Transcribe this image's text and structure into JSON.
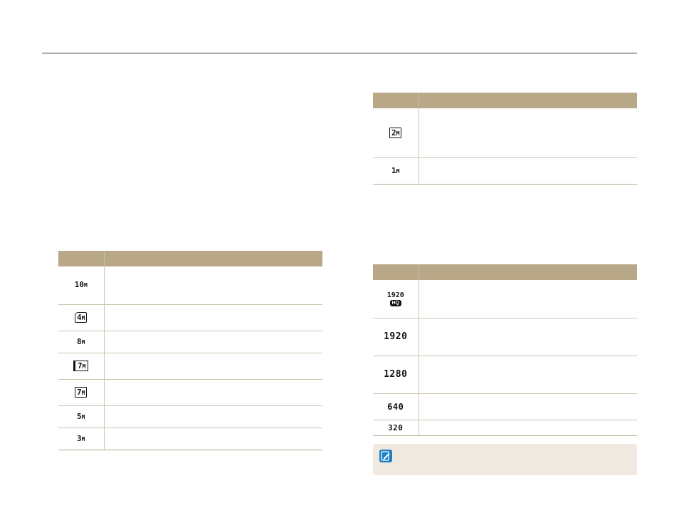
{
  "colors": {
    "table_header": "#b9a888",
    "row_divider": "#cfc3b0",
    "note_background": "#efe9e0",
    "note_icon": "#1d7fc4",
    "top_rule": "#3a3a3a"
  },
  "photo_size_table": {
    "header": [
      "",
      ""
    ],
    "rows": [
      {
        "icon": "10m-size-icon",
        "glyph": "10",
        "unit": "M",
        "style": "plain",
        "text": ""
      },
      {
        "icon": "4m-wide-size-icon",
        "glyph": "4",
        "unit": "M",
        "style": "pano",
        "text": ""
      },
      {
        "icon": "8m-size-icon",
        "glyph": "8",
        "unit": "M",
        "style": "plain",
        "text": ""
      },
      {
        "icon": "7m-wide-size-icon",
        "glyph": "7",
        "unit": "M",
        "style": "wide",
        "text": ""
      },
      {
        "icon": "7m-size-icon",
        "glyph": "7",
        "unit": "M",
        "style": "boxed",
        "text": ""
      },
      {
        "icon": "5m-size-icon",
        "glyph": "5",
        "unit": "M",
        "style": "plain",
        "text": ""
      },
      {
        "icon": "3m-size-icon",
        "glyph": "3",
        "unit": "M",
        "style": "plain",
        "text": ""
      }
    ]
  },
  "photo_size_table_cont": {
    "header": [
      "",
      ""
    ],
    "rows": [
      {
        "icon": "2m-wide-size-icon",
        "glyph": "2",
        "unit": "M",
        "style": "boxed",
        "text": ""
      },
      {
        "icon": "1m-size-icon",
        "glyph": "1",
        "unit": "M",
        "style": "plain",
        "text": ""
      }
    ]
  },
  "video_size_table": {
    "header": [
      "",
      ""
    ],
    "rows": [
      {
        "icon": "1920-hq-size-icon",
        "glyph": "1920",
        "badge": "HQ",
        "text": ""
      },
      {
        "icon": "1920-size-icon",
        "glyph": "1920",
        "text": ""
      },
      {
        "icon": "1280-size-icon",
        "glyph": "1280",
        "text": ""
      },
      {
        "icon": "640-size-icon",
        "glyph": "640",
        "text": ""
      },
      {
        "icon": "320-size-icon",
        "glyph": "320",
        "text": ""
      }
    ]
  },
  "note": {
    "icon": "note-pencil-icon",
    "text": ""
  }
}
